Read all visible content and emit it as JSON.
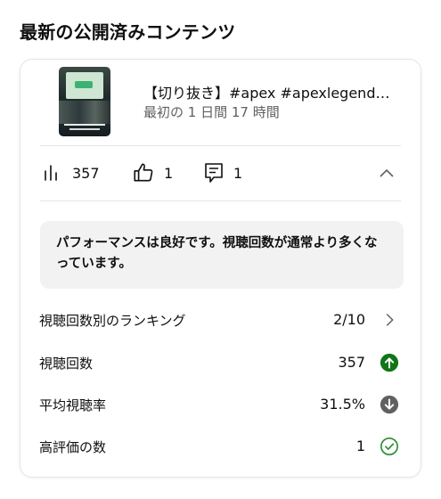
{
  "section": {
    "title": "最新の公開済みコンテンツ"
  },
  "video": {
    "title": "【切り抜き】#apex #apexlegend…",
    "subtitle": "最初の 1 日間 17 時間"
  },
  "stats": {
    "views": "357",
    "likes": "1",
    "comments": "1"
  },
  "performance": {
    "message": "パフォーマンスは良好です。視聴回数が通常より多くなっています。"
  },
  "metrics": [
    {
      "label": "視聴回数別のランキング",
      "value": "2/10",
      "icon": "chevron-right-icon"
    },
    {
      "label": "視聴回数",
      "value": "357",
      "icon": "arrow-up-circle-icon"
    },
    {
      "label": "平均視聴率",
      "value": "31.5%",
      "icon": "arrow-down-circle-icon"
    },
    {
      "label": "高評価の数",
      "value": "1",
      "icon": "check-circle-icon"
    }
  ],
  "colors": {
    "up": "#107516",
    "down": "#606060",
    "check": "#2a8f32"
  }
}
